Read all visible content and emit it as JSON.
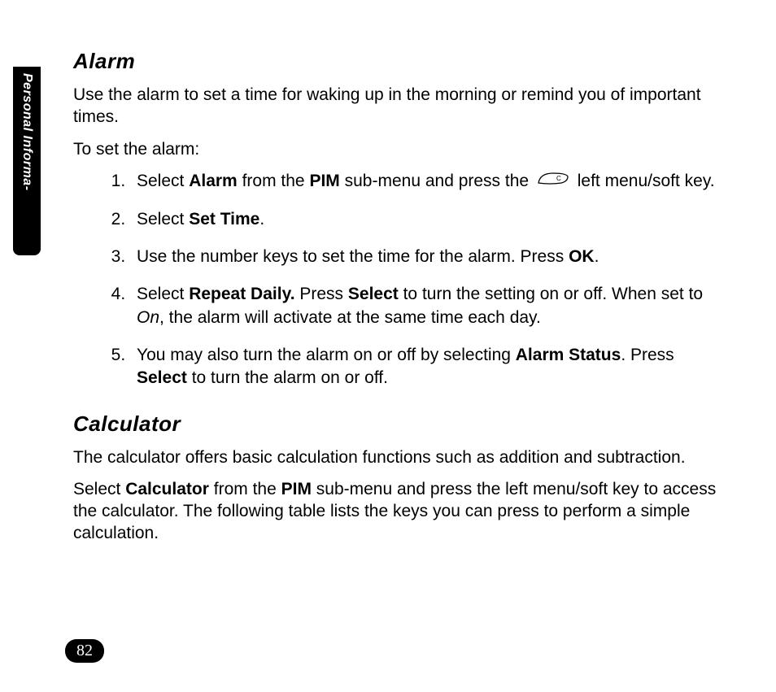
{
  "sideTab": "Personal Informa-",
  "alarm": {
    "heading": "Alarm",
    "intro": "Use the alarm to set a time for waking up in the morning or remind you of important times.",
    "toSet": "To set the alarm:",
    "steps": {
      "s1_a": "Select ",
      "s1_alarm": "Alarm",
      "s1_b": " from the ",
      "s1_pim": "PIM",
      "s1_c": " sub-menu and press the ",
      "s1_d": " left menu/soft key.",
      "s2_a": "Select ",
      "s2_settime": "Set Time",
      "s2_b": ".",
      "s3_a": "Use the number keys to set the time for the alarm. Press ",
      "s3_ok": "OK",
      "s3_b": ".",
      "s4_a": "Select ",
      "s4_repeat": "Repeat Daily.",
      "s4_b": " Press ",
      "s4_select": "Select",
      "s4_c": " to turn the setting on or off. When set to ",
      "s4_on": "On",
      "s4_d": ", the alarm will activate at the same time each day.",
      "s5_a": "You may also turn the alarm on or off by selecting ",
      "s5_status": "Alarm Status",
      "s5_b": ". Press ",
      "s5_select": "Select",
      "s5_c": " to turn the alarm on or off."
    }
  },
  "calculator": {
    "heading": "Calculator",
    "intro": "The calculator offers basic calculation functions such as addition and subtraction.",
    "p2_a": "Select ",
    "p2_calc": "Calculator",
    "p2_b": " from the ",
    "p2_pim": "PIM",
    "p2_c": " sub-menu and press the left menu/soft key to access the calculator. The following table lists the keys you can press to perform a simple calculation."
  },
  "pageNumber": "82"
}
